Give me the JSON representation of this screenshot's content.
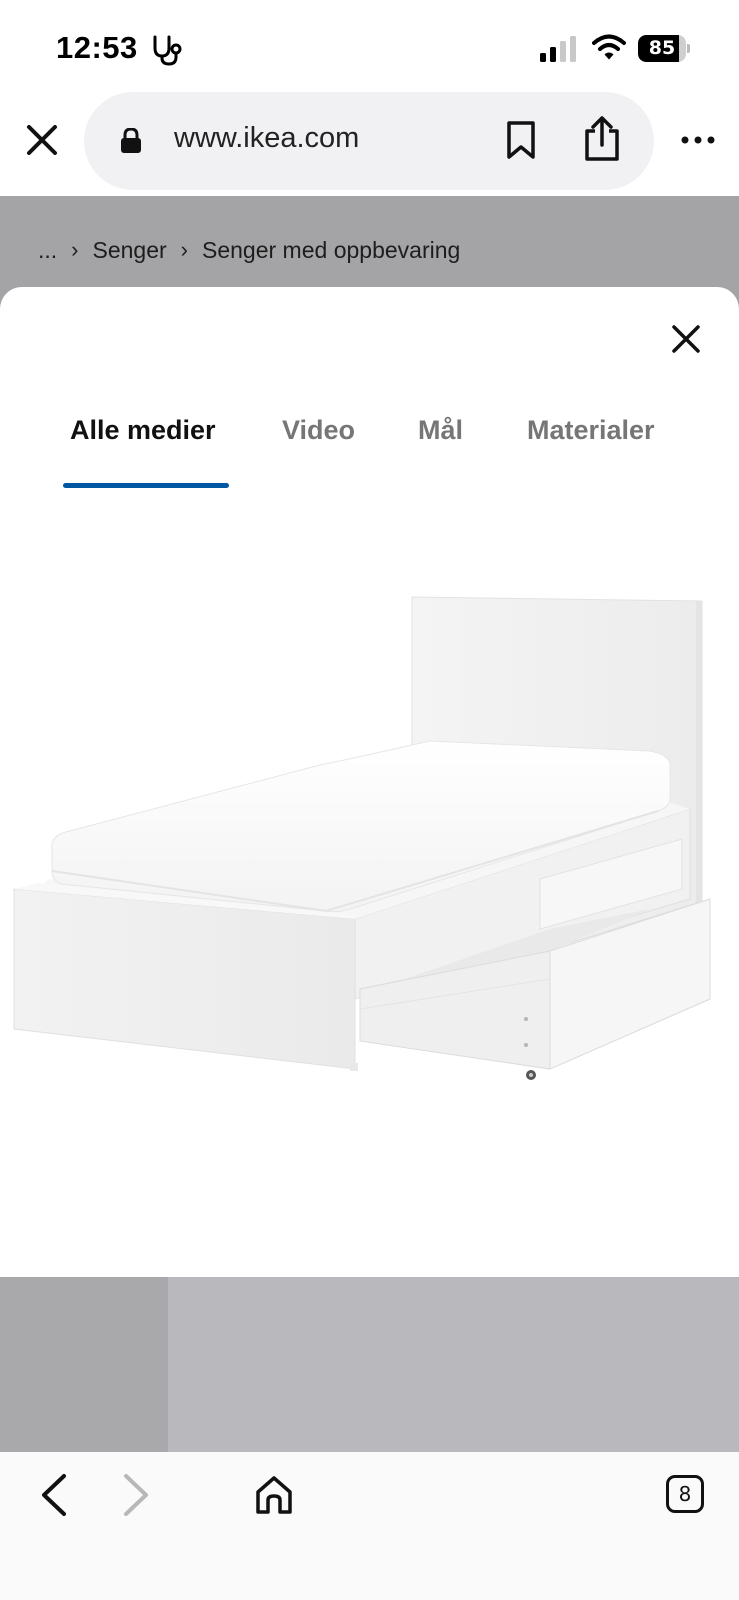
{
  "status_bar": {
    "time": "12:53",
    "battery_percent": "85",
    "battery_level": 0.85,
    "signal_bars_active": 2,
    "icons": [
      "health-stethoscope-icon",
      "cellular-signal-icon",
      "wifi-icon",
      "battery-icon"
    ]
  },
  "browser": {
    "url": "www.ikea.com",
    "icons": [
      "close-icon",
      "lock-icon",
      "bookmark-icon",
      "share-icon",
      "more-icon"
    ]
  },
  "breadcrumb": {
    "ellipsis": "...",
    "separator": "›",
    "items": [
      "Senger",
      "Senger med oppbevaring"
    ]
  },
  "modal": {
    "close_icon": "close-icon",
    "tabs": [
      {
        "label": "Alle medier",
        "active": true
      },
      {
        "label": "Video",
        "active": false
      },
      {
        "label": "Mål",
        "active": false
      },
      {
        "label": "Materialer",
        "active": false
      }
    ],
    "accent_color": "#0058a3",
    "image": "white single bed with headboard and open under-bed storage drawer"
  },
  "toolbar": {
    "tab_count": "8",
    "icons": [
      "back-icon",
      "forward-icon",
      "home-icon",
      "tabs-icon"
    ]
  }
}
